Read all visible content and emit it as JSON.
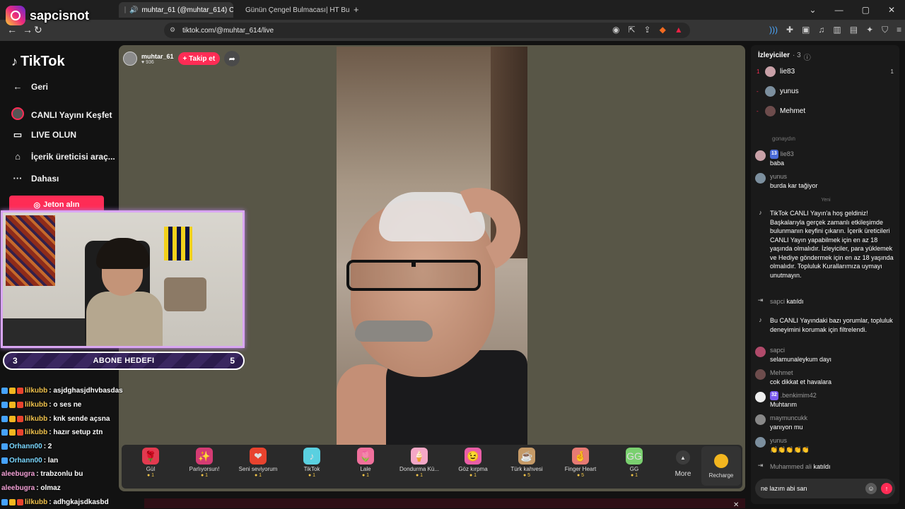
{
  "overlay": {
    "channel_name": "sapcisnot"
  },
  "browser": {
    "tabs": [
      {
        "label": "muhtar_61 (@muhtar_614) C",
        "active": true
      },
      {
        "label": "Günün Çengel Bulmacası| HT Bulmac",
        "active": false
      }
    ],
    "new_tab": "+",
    "url": "tiktok.com/@muhtar_614/live"
  },
  "left_nav": {
    "logo": "TikTok",
    "items": [
      {
        "label": "Geri",
        "icon": "arrow-left-icon"
      },
      {
        "label": "CANLI Yayını Keşfet",
        "icon": "live-explore-icon"
      },
      {
        "label": "LIVE OLUN",
        "icon": "camera-icon"
      },
      {
        "label": "İçerik üreticisi araç...",
        "icon": "creator-tools-icon"
      },
      {
        "label": "Dahası",
        "icon": "more-icon"
      }
    ],
    "jeton_button": "Jeton alın"
  },
  "subgoal": {
    "current": "3",
    "title": "ABONE HEDEFI",
    "target": "5"
  },
  "overlay_chat": [
    {
      "user": "lilkubb",
      "text": ": asjdghasjdhvbasdas"
    },
    {
      "user": "lilkubb",
      "text": ": o ses ne"
    },
    {
      "user": "lilkubb",
      "text": ": knk sende açsna"
    },
    {
      "user": "lilkubb",
      "text": ": hazır setup ztn"
    },
    {
      "user": "Orhann00",
      "text": ": 2"
    },
    {
      "user": "Orhann00",
      "text": ": lan"
    },
    {
      "user": "aleebugra",
      "text": ": trabzonlu bu"
    },
    {
      "user": "aleebugra",
      "text": ": olmaz"
    },
    {
      "user": "lilkubb",
      "text": ": adhgkajsdkasbd"
    }
  ],
  "host": {
    "name": "muhtar_61",
    "likes": "936",
    "follow_label": "+ Takip et"
  },
  "gifts": [
    {
      "name": "Gül",
      "price": "1",
      "color": "#e23a4f",
      "glyph": "🌹"
    },
    {
      "name": "Parlıyorsun!",
      "price": "1",
      "color": "#d43b73",
      "glyph": "✨"
    },
    {
      "name": "Seni seviyorum",
      "price": "1",
      "color": "#e8432e",
      "glyph": "❤"
    },
    {
      "name": "TikTok",
      "price": "1",
      "color": "#5ad0e0",
      "glyph": "♪"
    },
    {
      "name": "Lale",
      "price": "1",
      "color": "#f0709c",
      "glyph": "🌷"
    },
    {
      "name": "Dondurma Kü...",
      "price": "1",
      "color": "#f4a7c6",
      "glyph": "🍦"
    },
    {
      "name": "Göz kırpma",
      "price": "1",
      "color": "#e95ea6",
      "glyph": "😉"
    },
    {
      "name": "Türk kahvesi",
      "price": "5",
      "color": "#c59a67",
      "glyph": "☕"
    },
    {
      "name": "Finger Heart",
      "price": "5",
      "color": "#e77a73",
      "glyph": "🤞"
    },
    {
      "name": "GG",
      "price": "1",
      "color": "#7ad06f",
      "glyph": "GG"
    }
  ],
  "more_label": "More",
  "recharge_label": "Recharge",
  "viewers": {
    "title": "İzleyiciler",
    "count": "· 3",
    "list": [
      {
        "rank": "1",
        "name": "lie83",
        "score": "1",
        "color": "#c9a1a8"
      },
      {
        "rank": "-",
        "name": "yunus",
        "score": "",
        "color": "#7c8f9e"
      },
      {
        "rank": "-",
        "name": "Mehmet",
        "score": "",
        "color": "#6d4c4c"
      }
    ]
  },
  "comments": {
    "partial_top": "gonaydın",
    "items": [
      {
        "kind": "user",
        "name": "lie83",
        "level": "13",
        "text": "baba"
      },
      {
        "kind": "user",
        "name": "yunus",
        "level": "",
        "text": "burda kar tağiyor"
      },
      {
        "kind": "system",
        "name": "",
        "level": "",
        "text": "TikTok CANLI Yayın'a hoş geldiniz! Başkalarıyla gerçek zamanlı etkileşimde bulunmanın keyfini çıkarın. İçerik üreticileri CANLI Yayın yapabilmek için en az 18 yaşında olmalıdır. İzleyiciler, para yüklemek ve Hediye göndermek için en az 18 yaşında olmalıdır. Topluluk Kurallarımıza uymayı unutmayın."
      },
      {
        "kind": "join",
        "name": "sapci",
        "level": "",
        "text": "katıldı"
      },
      {
        "kind": "system",
        "name": "",
        "level": "",
        "text": "Bu CANLI Yayındaki bazı yorumlar, topluluk deneyimini korumak için filtrelendi."
      },
      {
        "kind": "user",
        "name": "sapci",
        "level": "",
        "text": "selamunaleykum dayı"
      },
      {
        "kind": "user",
        "name": "Mehmet",
        "level": "",
        "text": "cok dikkat et havalara"
      },
      {
        "kind": "user",
        "name": ".benkimim42",
        "level": "32",
        "text": "Muhtarım"
      },
      {
        "kind": "user",
        "name": "maymuncukk",
        "level": "",
        "text": "yanıyon mu"
      },
      {
        "kind": "user",
        "name": "yunus",
        "level": "",
        "text": "👏👏👏👏👏"
      },
      {
        "kind": "join",
        "name": "Muhammed ali",
        "level": "",
        "text": "katıldı"
      }
    ],
    "new_label": "Yeni"
  },
  "chat_input": {
    "value": "ne lazım abi san"
  }
}
